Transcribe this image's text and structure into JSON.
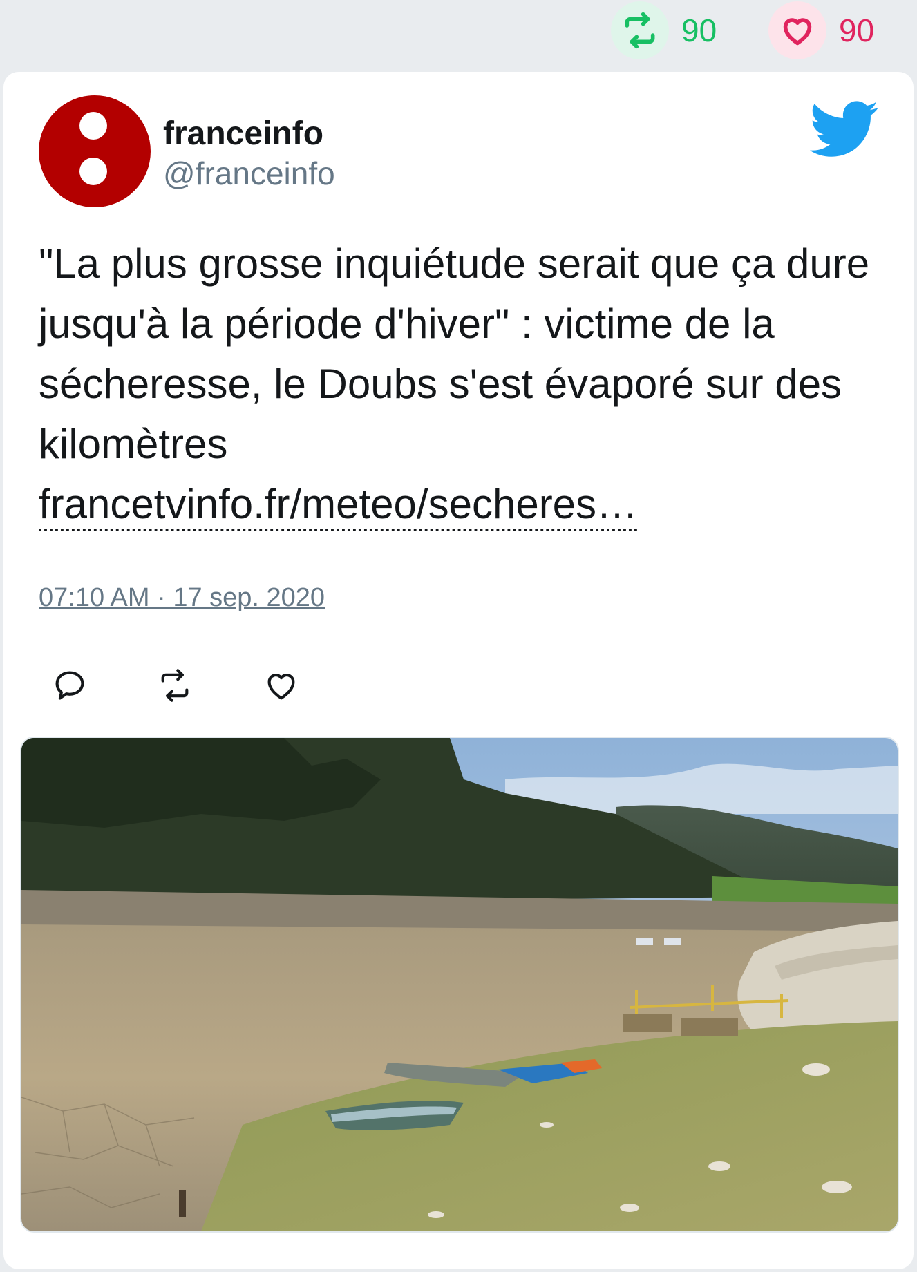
{
  "stats": {
    "retweet_count": "90",
    "like_count": "90",
    "retweet_color": "#17bf63",
    "like_color": "#e0245e"
  },
  "tweet": {
    "author_name": "franceinfo",
    "author_handle": "@franceinfo",
    "avatar_color": "#b30000",
    "platform_icon": "twitter-bird-icon",
    "text": "\"La plus grosse inquiétude serait que ça dure jusqu'à la période d'hiver\" : victime de la sécheresse, le Doubs s'est évaporé sur des kilomètres",
    "link": "francetvinfo.fr/meteo/secheres…",
    "timestamp": "07:10 AM · 17 sep. 2020",
    "actions": [
      "reply-icon",
      "retweet-icon",
      "like-icon"
    ],
    "media": "photo of dried-up Doubs riverbed with boats on cracked ground"
  }
}
